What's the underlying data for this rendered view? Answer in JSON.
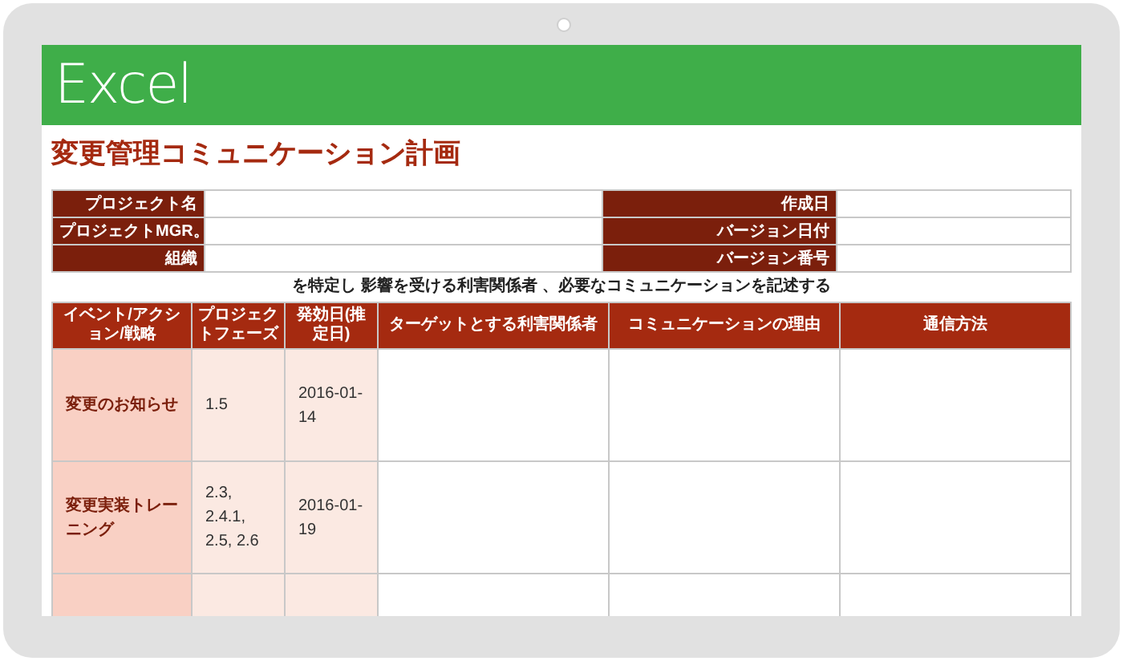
{
  "app": {
    "name": "Excel"
  },
  "title": "変更管理コミュニケーション計画",
  "info_fields": [
    {
      "label": "プロジェクト名"
    },
    {
      "label": "作成日"
    },
    {
      "label": "プロジェクトMGR。"
    },
    {
      "label": "バージョン日付"
    },
    {
      "label": "組織"
    },
    {
      "label": "バージョン番号"
    }
  ],
  "instruction": "を特定し 影響を受ける利害関係者 、必要なコミュニケーションを記述する",
  "table": {
    "columns": [
      "イベント/アクション/戦略",
      "プロジェクトフェーズ",
      "発効日(推定日)",
      "ターゲットとする利害関係者",
      "コミュニケーションの理由",
      "通信方法"
    ],
    "rows": [
      {
        "event": "変更のお知らせ",
        "phase": "1.5",
        "date": "2016-01-14"
      },
      {
        "event": "変更実装トレーニング",
        "phase": "2.3, 2.4.1, 2.5, 2.6",
        "date": "2016-01-19"
      },
      {}
    ]
  }
}
